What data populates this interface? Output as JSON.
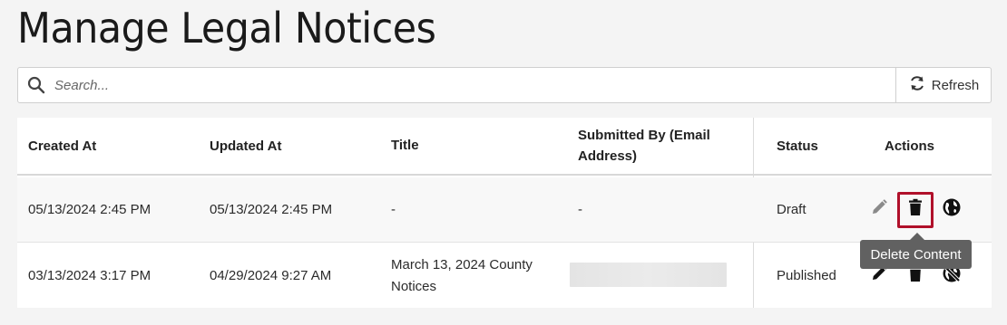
{
  "page": {
    "title": "Manage Legal Notices"
  },
  "search": {
    "placeholder": "Search...",
    "value": ""
  },
  "toolbar": {
    "refresh_label": "Refresh"
  },
  "table": {
    "headers": {
      "created_at": "Created At",
      "updated_at": "Updated At",
      "title": "Title",
      "submitted_by": "Submitted By (Email Address)",
      "status": "Status",
      "actions": "Actions"
    },
    "rows": [
      {
        "created_at": "05/13/2024 2:45 PM",
        "updated_at": "05/13/2024 2:45 PM",
        "title": "-",
        "submitted_by": "-",
        "status": "Draft"
      },
      {
        "created_at": "03/13/2024 3:17 PM",
        "updated_at": "04/29/2024 9:27 AM",
        "title": "March 13, 2024 County Notices",
        "submitted_by": "",
        "status": "Published"
      }
    ]
  },
  "tooltip": {
    "text": "Delete Content"
  },
  "icons": {
    "search": "search-icon",
    "refresh": "refresh-icon",
    "edit": "pencil-icon",
    "delete": "trash-icon",
    "publish": "globe-icon",
    "unpublish": "globe-off-icon"
  },
  "colors": {
    "highlight": "#b0102a",
    "tooltip_bg": "#616161",
    "disabled_icon": "#8a8a8a"
  }
}
